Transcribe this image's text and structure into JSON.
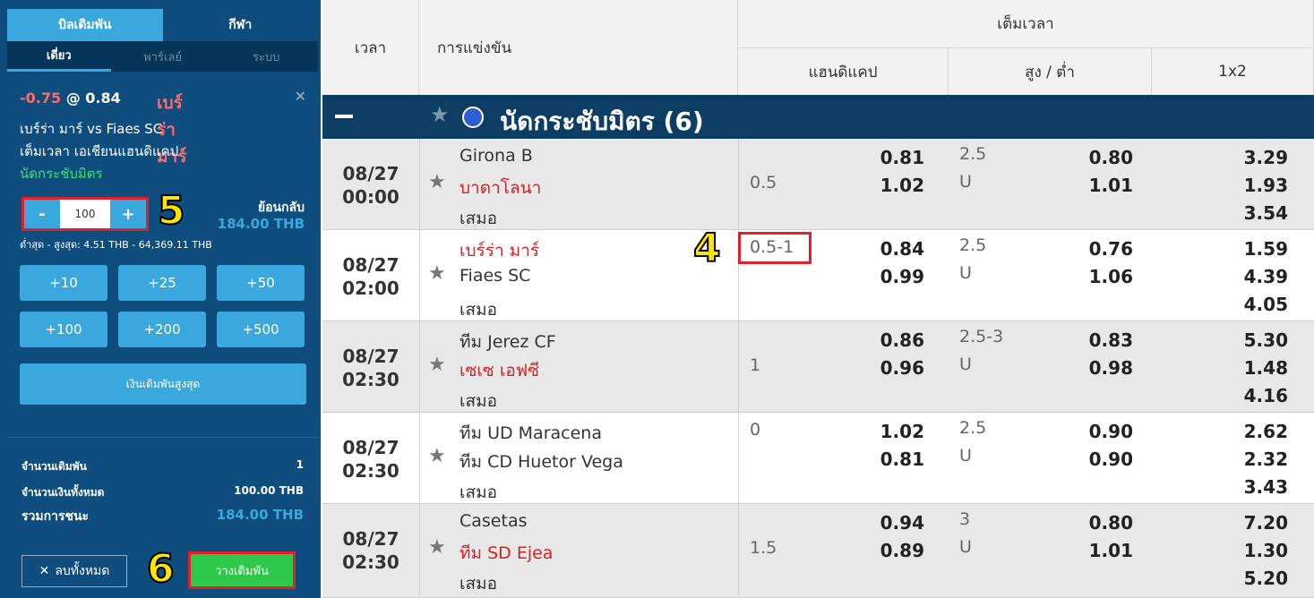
{
  "slip": {
    "tab_betslip": "บิลเดิมพัน",
    "tab_sports": "กีฬา",
    "sub_single": "เดี่ยว",
    "sub_parlay": "พาร์เลย์",
    "sub_system": "ระบบ",
    "selection_team": "เบร์ร่า มาร์",
    "selection_hcap": "-0.75",
    "selection_at": "@",
    "selection_odds": "0.84",
    "match": "เบร์ร่า มาร์ vs Fiaes SC",
    "market": "เต็มเวลา เอเชียนแฮนดิแคป",
    "league": "นัดกระชับมิตร",
    "stake_minus": "-",
    "stake_value": "100",
    "stake_plus": "+",
    "step5": "5",
    "payout_label": "ย้อนกลับ",
    "payout_value": "184.00 THB",
    "minmax": "ต่ำสุด - สูงสุด: 4.51 THB - 64,369.11 THB",
    "quick": [
      "+10",
      "+25",
      "+50",
      "+100",
      "+200",
      "+500"
    ],
    "max_button": "เงินเดิมพันสูงสุด",
    "count_label": "จำนวนเดิมพัน",
    "count_value": "1",
    "total_label": "จำนวนเงินทั้งหมด",
    "total_value": "100.00 THB",
    "win_label": "รวมการชนะ",
    "win_value": "184.00 THB",
    "clear_button": "ลบทั้งหมด",
    "step6": "6",
    "place_button": "วางเดิมพัน"
  },
  "table": {
    "col_time": "เวลา",
    "col_match": "การแข่งขัน",
    "col_fulltime": "เต็มเวลา",
    "col_handicap": "แฮนดิแคป",
    "col_ou": "สูง / ต่ำ",
    "col_1x2": "1x2",
    "league_name": "นัดกระชับมิตร (6)",
    "step4": "4",
    "rows": [
      {
        "date": "08/27",
        "time": "00:00",
        "home": "Girona B",
        "away": "บาดาโลนา",
        "draw": "เสมอ",
        "hcap": "0.5",
        "h1": "0.81",
        "h2": "1.02",
        "ou": "2.5",
        "u": "U",
        "o1": "0.80",
        "o2": "1.01",
        "x1": "3.29",
        "x2": "1.93",
        "x3": "3.54"
      },
      {
        "date": "08/27",
        "time": "02:00",
        "home": "เบร์ร่า มาร์",
        "away": "Fiaes SC",
        "draw": "เสมอ",
        "hcap": "0.5-1",
        "h1": "0.84",
        "h2": "0.99",
        "ou": "2.5",
        "u": "U",
        "o1": "0.76",
        "o2": "1.06",
        "x1": "1.59",
        "x2": "4.39",
        "x3": "4.05"
      },
      {
        "date": "08/27",
        "time": "02:30",
        "home": "ทีม Jerez CF",
        "away": "เซเซ เอฟซี",
        "draw": "เสมอ",
        "hcap": "1",
        "h1": "0.86",
        "h2": "0.96",
        "ou": "2.5-3",
        "u": "U",
        "o1": "0.83",
        "o2": "0.98",
        "x1": "5.30",
        "x2": "1.48",
        "x3": "4.16"
      },
      {
        "date": "08/27",
        "time": "02:30",
        "home": "ทีม UD Maracena",
        "away": "ทีม CD Huetor Vega",
        "draw": "เสมอ",
        "hcap": "0",
        "h1": "1.02",
        "h2": "0.81",
        "ou": "2.5",
        "u": "U",
        "o1": "0.90",
        "o2": "0.90",
        "x1": "2.62",
        "x2": "2.32",
        "x3": "3.43"
      },
      {
        "date": "08/27",
        "time": "02:30",
        "home": "Casetas",
        "away": "ทีม SD Ejea",
        "draw": "เสมอ",
        "hcap": "1.5",
        "h1": "0.94",
        "h2": "0.89",
        "ou": "3",
        "u": "U",
        "o1": "0.80",
        "o2": "1.01",
        "x1": "7.20",
        "x2": "1.30",
        "x3": "5.20"
      }
    ]
  }
}
